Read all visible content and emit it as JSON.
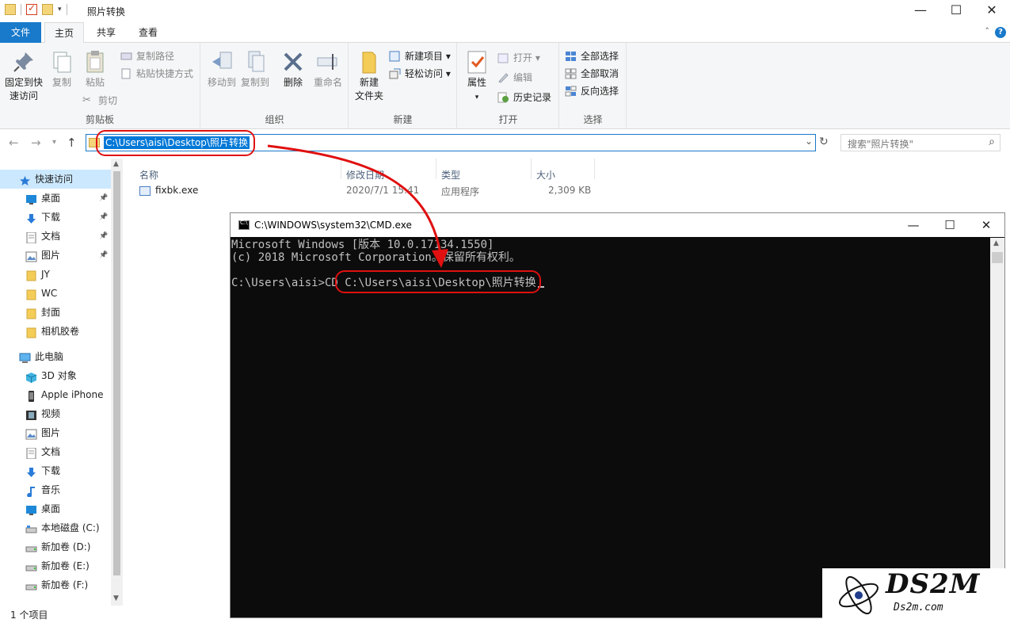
{
  "explorer": {
    "title": "照片转换",
    "tabs": [
      "文件",
      "主页",
      "共享",
      "查看"
    ],
    "ribbon": {
      "clipboard": {
        "label": "剪贴板",
        "pin": "固定到快\n速访问",
        "copy": "复制",
        "paste": "粘贴",
        "copy_path": "复制路径",
        "paste_shortcut": "粘贴快捷方式",
        "cut": "剪切"
      },
      "organize": {
        "label": "组织",
        "move_to": "移动到",
        "copy_to": "复制到",
        "delete": "删除",
        "rename": "重命名"
      },
      "new": {
        "label": "新建",
        "new_folder": "新建\n文件夹",
        "new_item": "新建项目",
        "easy_access": "轻松访问"
      },
      "open": {
        "label": "打开",
        "properties": "属性",
        "open": "打开",
        "edit": "编辑",
        "history": "历史记录"
      },
      "select": {
        "label": "选择",
        "select_all": "全部选择",
        "select_none": "全部取消",
        "invert": "反向选择"
      }
    },
    "address": "C:\\Users\\aisi\\Desktop\\照片转换",
    "search_placeholder": "搜索\"照片转换\"",
    "nav": [
      {
        "label": "快速访问",
        "icon": "star-icon",
        "indent": 1,
        "selected": true
      },
      {
        "label": "桌面",
        "icon": "desktop-icon",
        "indent": 2,
        "pinned": true
      },
      {
        "label": "下载",
        "icon": "download-icon",
        "indent": 2,
        "pinned": true
      },
      {
        "label": "文档",
        "icon": "document-icon",
        "indent": 2,
        "pinned": true
      },
      {
        "label": "图片",
        "icon": "picture-icon",
        "indent": 2,
        "pinned": true
      },
      {
        "label": "JY",
        "icon": "folder-icon",
        "indent": 2
      },
      {
        "label": "WC",
        "icon": "folder-icon",
        "indent": 2
      },
      {
        "label": "封面",
        "icon": "folder-icon",
        "indent": 2
      },
      {
        "label": "相机胶卷",
        "icon": "folder-icon",
        "indent": 2
      },
      {
        "label": "此电脑",
        "icon": "computer-icon",
        "indent": 1
      },
      {
        "label": "3D 对象",
        "icon": "cube-icon",
        "indent": 2
      },
      {
        "label": "Apple iPhone",
        "icon": "phone-icon",
        "indent": 2
      },
      {
        "label": "视频",
        "icon": "video-icon",
        "indent": 2
      },
      {
        "label": "图片",
        "icon": "picture-icon",
        "indent": 2
      },
      {
        "label": "文档",
        "icon": "document-icon",
        "indent": 2
      },
      {
        "label": "下载",
        "icon": "download-icon",
        "indent": 2
      },
      {
        "label": "音乐",
        "icon": "music-icon",
        "indent": 2
      },
      {
        "label": "桌面",
        "icon": "desktop-icon",
        "indent": 2
      },
      {
        "label": "本地磁盘 (C:)",
        "icon": "disk-icon",
        "indent": 2
      },
      {
        "label": "新加卷 (D:)",
        "icon": "drive-icon",
        "indent": 2
      },
      {
        "label": "新加卷 (E:)",
        "icon": "drive-icon",
        "indent": 2
      },
      {
        "label": "新加卷 (F:)",
        "icon": "drive-icon",
        "indent": 2
      }
    ],
    "columns": [
      "名称",
      "修改日期",
      "类型",
      "大小"
    ],
    "files": [
      {
        "name": "fixbk.exe",
        "modified": "2020/7/1 15:41",
        "type": "应用程序",
        "size": "2,309 KB"
      }
    ],
    "status": "1 个项目"
  },
  "cmd": {
    "title": "C:\\WINDOWS\\system32\\CMD.exe",
    "lines": [
      "Microsoft Windows [版本 10.0.17134.1550]",
      "(c) 2018 Microsoft Corporation。保留所有权利。",
      "",
      "C:\\Users\\aisi>CD C:\\Users\\aisi\\Desktop\\照片转换"
    ]
  },
  "watermark": {
    "brand": "DS2M",
    "site": "Ds2m.com"
  },
  "colors": {
    "accent": "#1979ca",
    "selection": "#0078d7",
    "annotation": "#e01010",
    "console_bg": "#0c0c0c"
  }
}
